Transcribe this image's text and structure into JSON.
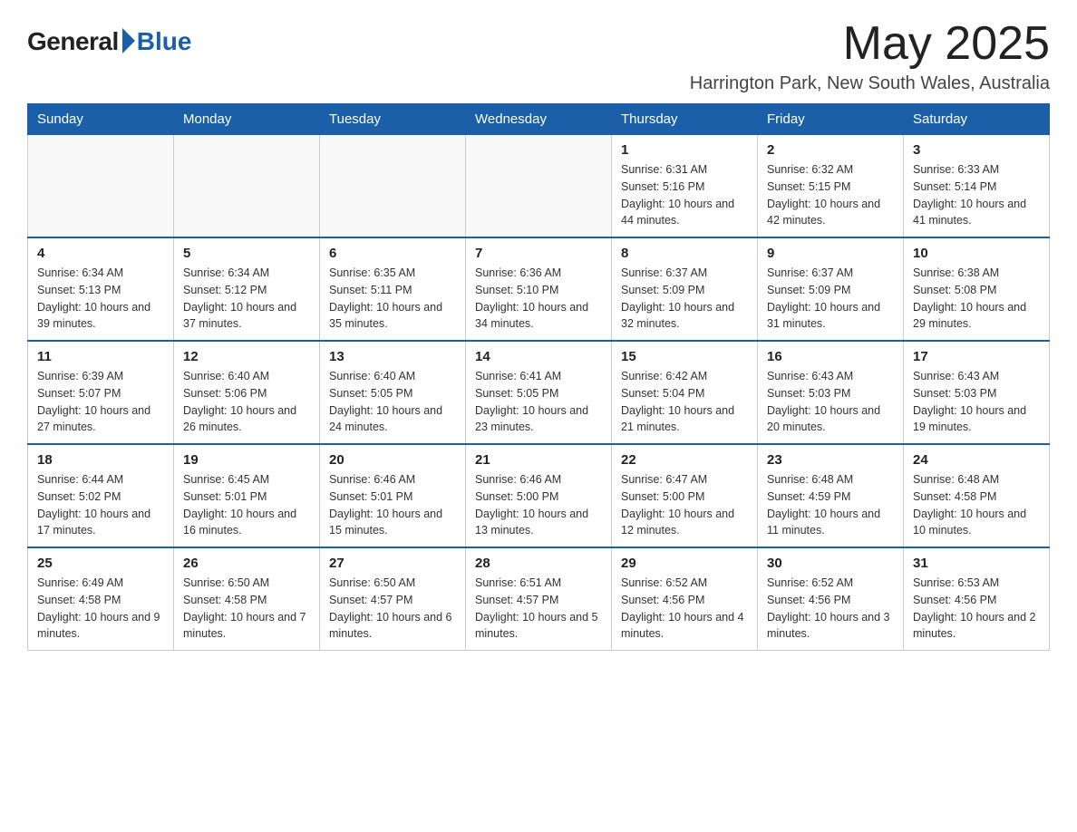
{
  "logo": {
    "general": "General",
    "blue": "Blue"
  },
  "title": {
    "month_year": "May 2025",
    "location": "Harrington Park, New South Wales, Australia"
  },
  "days_of_week": [
    "Sunday",
    "Monday",
    "Tuesday",
    "Wednesday",
    "Thursday",
    "Friday",
    "Saturday"
  ],
  "weeks": [
    [
      {
        "day": "",
        "info": ""
      },
      {
        "day": "",
        "info": ""
      },
      {
        "day": "",
        "info": ""
      },
      {
        "day": "",
        "info": ""
      },
      {
        "day": "1",
        "info": "Sunrise: 6:31 AM\nSunset: 5:16 PM\nDaylight: 10 hours and 44 minutes."
      },
      {
        "day": "2",
        "info": "Sunrise: 6:32 AM\nSunset: 5:15 PM\nDaylight: 10 hours and 42 minutes."
      },
      {
        "day": "3",
        "info": "Sunrise: 6:33 AM\nSunset: 5:14 PM\nDaylight: 10 hours and 41 minutes."
      }
    ],
    [
      {
        "day": "4",
        "info": "Sunrise: 6:34 AM\nSunset: 5:13 PM\nDaylight: 10 hours and 39 minutes."
      },
      {
        "day": "5",
        "info": "Sunrise: 6:34 AM\nSunset: 5:12 PM\nDaylight: 10 hours and 37 minutes."
      },
      {
        "day": "6",
        "info": "Sunrise: 6:35 AM\nSunset: 5:11 PM\nDaylight: 10 hours and 35 minutes."
      },
      {
        "day": "7",
        "info": "Sunrise: 6:36 AM\nSunset: 5:10 PM\nDaylight: 10 hours and 34 minutes."
      },
      {
        "day": "8",
        "info": "Sunrise: 6:37 AM\nSunset: 5:09 PM\nDaylight: 10 hours and 32 minutes."
      },
      {
        "day": "9",
        "info": "Sunrise: 6:37 AM\nSunset: 5:09 PM\nDaylight: 10 hours and 31 minutes."
      },
      {
        "day": "10",
        "info": "Sunrise: 6:38 AM\nSunset: 5:08 PM\nDaylight: 10 hours and 29 minutes."
      }
    ],
    [
      {
        "day": "11",
        "info": "Sunrise: 6:39 AM\nSunset: 5:07 PM\nDaylight: 10 hours and 27 minutes."
      },
      {
        "day": "12",
        "info": "Sunrise: 6:40 AM\nSunset: 5:06 PM\nDaylight: 10 hours and 26 minutes."
      },
      {
        "day": "13",
        "info": "Sunrise: 6:40 AM\nSunset: 5:05 PM\nDaylight: 10 hours and 24 minutes."
      },
      {
        "day": "14",
        "info": "Sunrise: 6:41 AM\nSunset: 5:05 PM\nDaylight: 10 hours and 23 minutes."
      },
      {
        "day": "15",
        "info": "Sunrise: 6:42 AM\nSunset: 5:04 PM\nDaylight: 10 hours and 21 minutes."
      },
      {
        "day": "16",
        "info": "Sunrise: 6:43 AM\nSunset: 5:03 PM\nDaylight: 10 hours and 20 minutes."
      },
      {
        "day": "17",
        "info": "Sunrise: 6:43 AM\nSunset: 5:03 PM\nDaylight: 10 hours and 19 minutes."
      }
    ],
    [
      {
        "day": "18",
        "info": "Sunrise: 6:44 AM\nSunset: 5:02 PM\nDaylight: 10 hours and 17 minutes."
      },
      {
        "day": "19",
        "info": "Sunrise: 6:45 AM\nSunset: 5:01 PM\nDaylight: 10 hours and 16 minutes."
      },
      {
        "day": "20",
        "info": "Sunrise: 6:46 AM\nSunset: 5:01 PM\nDaylight: 10 hours and 15 minutes."
      },
      {
        "day": "21",
        "info": "Sunrise: 6:46 AM\nSunset: 5:00 PM\nDaylight: 10 hours and 13 minutes."
      },
      {
        "day": "22",
        "info": "Sunrise: 6:47 AM\nSunset: 5:00 PM\nDaylight: 10 hours and 12 minutes."
      },
      {
        "day": "23",
        "info": "Sunrise: 6:48 AM\nSunset: 4:59 PM\nDaylight: 10 hours and 11 minutes."
      },
      {
        "day": "24",
        "info": "Sunrise: 6:48 AM\nSunset: 4:58 PM\nDaylight: 10 hours and 10 minutes."
      }
    ],
    [
      {
        "day": "25",
        "info": "Sunrise: 6:49 AM\nSunset: 4:58 PM\nDaylight: 10 hours and 9 minutes."
      },
      {
        "day": "26",
        "info": "Sunrise: 6:50 AM\nSunset: 4:58 PM\nDaylight: 10 hours and 7 minutes."
      },
      {
        "day": "27",
        "info": "Sunrise: 6:50 AM\nSunset: 4:57 PM\nDaylight: 10 hours and 6 minutes."
      },
      {
        "day": "28",
        "info": "Sunrise: 6:51 AM\nSunset: 4:57 PM\nDaylight: 10 hours and 5 minutes."
      },
      {
        "day": "29",
        "info": "Sunrise: 6:52 AM\nSunset: 4:56 PM\nDaylight: 10 hours and 4 minutes."
      },
      {
        "day": "30",
        "info": "Sunrise: 6:52 AM\nSunset: 4:56 PM\nDaylight: 10 hours and 3 minutes."
      },
      {
        "day": "31",
        "info": "Sunrise: 6:53 AM\nSunset: 4:56 PM\nDaylight: 10 hours and 2 minutes."
      }
    ]
  ]
}
